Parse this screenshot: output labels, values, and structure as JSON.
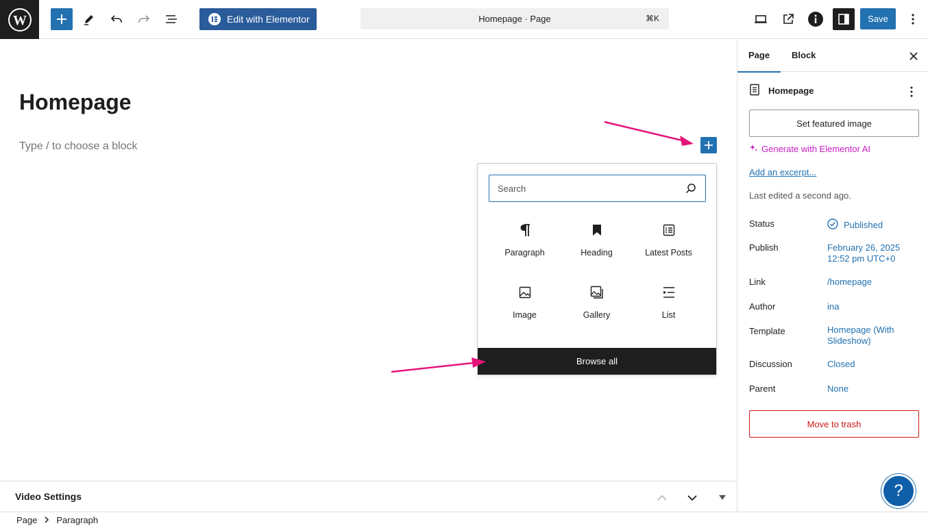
{
  "topbar": {
    "elementor_label": "Edit with Elementor",
    "command_title": "Homepage · Page",
    "command_shortcut": "⌘K",
    "save_label": "Save"
  },
  "editor": {
    "page_title": "Homepage",
    "placeholder": "Type / to choose a block"
  },
  "inserter": {
    "search_placeholder": "Search",
    "blocks": [
      {
        "label": "Paragraph",
        "icon": "paragraph-icon"
      },
      {
        "label": "Heading",
        "icon": "bookmark-icon"
      },
      {
        "label": "Latest Posts",
        "icon": "post-list-icon"
      },
      {
        "label": "Image",
        "icon": "image-icon"
      },
      {
        "label": "Gallery",
        "icon": "gallery-icon"
      },
      {
        "label": "List",
        "icon": "list-icon"
      }
    ],
    "browse_all": "Browse all"
  },
  "meta_box": {
    "title": "Video Settings"
  },
  "breadcrumb": {
    "items": [
      "Page",
      "Paragraph"
    ]
  },
  "sidebar": {
    "tabs": [
      "Page",
      "Block"
    ],
    "active_tab": "Page",
    "doc_title": "Homepage",
    "featured_image": "Set featured image",
    "generate_ai": "Generate with Elementor AI",
    "excerpt": "Add an excerpt...",
    "last_edited": "Last edited a second ago.",
    "props": [
      {
        "label": "Status",
        "value": "Published"
      },
      {
        "label": "Publish",
        "value": "February 26, 2025 12:52 pm UTC+0"
      },
      {
        "label": "Link",
        "value": "/homepage"
      },
      {
        "label": "Author",
        "value": "ina"
      },
      {
        "label": "Template",
        "value": "Homepage (With Slideshow)"
      },
      {
        "label": "Discussion",
        "value": "Closed"
      },
      {
        "label": "Parent",
        "value": "None"
      }
    ],
    "trash": "Move to trash"
  },
  "help": {
    "label": "?"
  },
  "colors": {
    "accent": "#2271b1",
    "annotation_arrow": "#e6147a",
    "ai_magenta": "#c51cc1",
    "danger": "#cc1818"
  }
}
